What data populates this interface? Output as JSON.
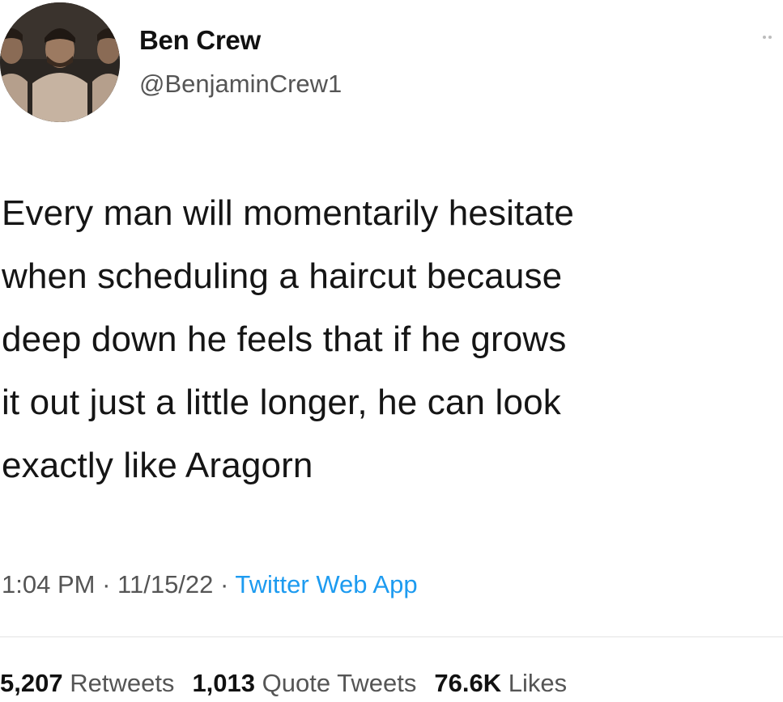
{
  "author": {
    "display_name": "Ben Crew",
    "handle": "@BenjaminCrew1"
  },
  "tweet": {
    "lines": [
      "Every man will momentarily hesitate",
      "when scheduling a haircut because",
      "deep down he feels that if he grows",
      "it out just a little longer, he can look",
      "exactly like Aragorn"
    ],
    "time": "1:04 PM",
    "date": "11/15/22",
    "separator": "·",
    "source": "Twitter Web App"
  },
  "stats": {
    "retweets_count": "5,207",
    "retweets_label": "Retweets",
    "quotes_count": "1,013",
    "quotes_label": "Quote Tweets",
    "likes_count": "76.6K",
    "likes_label": "Likes"
  },
  "colors": {
    "link": "#1d9bf0",
    "secondary_text": "#555555"
  },
  "icons": {
    "more": "more-dots-icon"
  }
}
